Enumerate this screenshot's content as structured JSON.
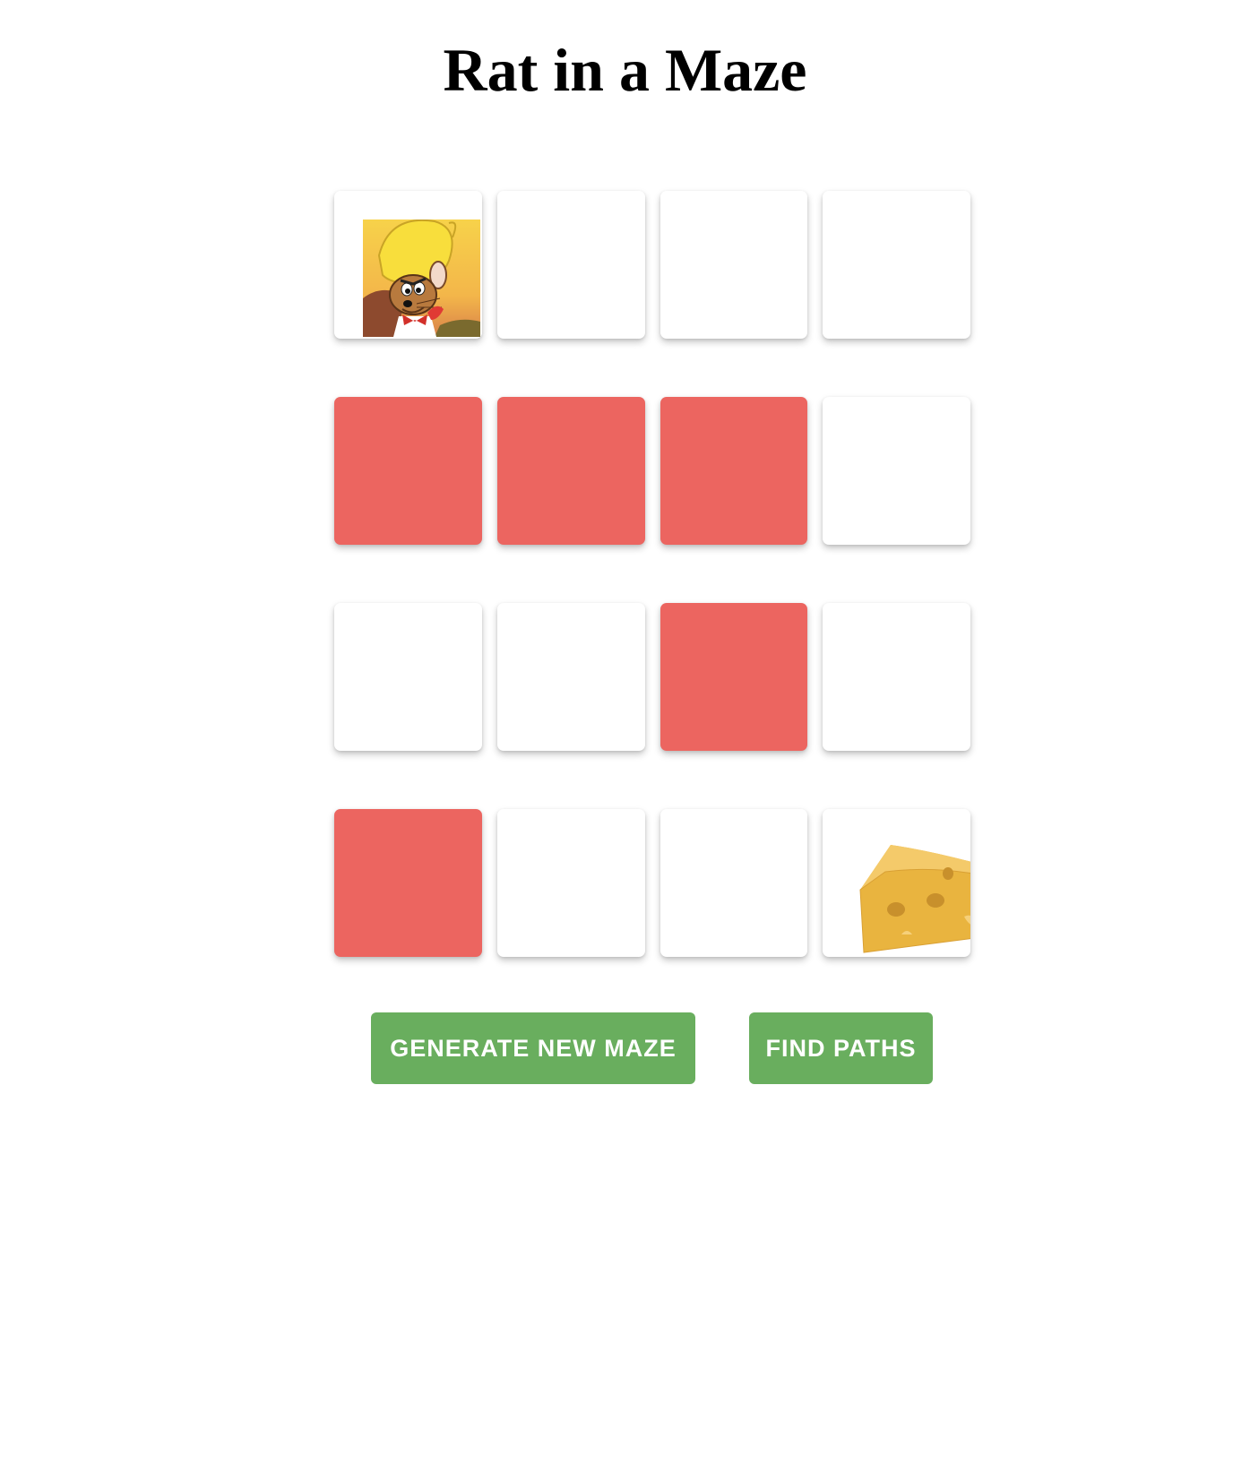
{
  "page": {
    "title": "Rat in a Maze"
  },
  "colors": {
    "open_cell": "#ffffff",
    "blocked_cell": "#ec6560",
    "button": "#69ae5e",
    "button_text": "#ffffff"
  },
  "maze": {
    "rows": 4,
    "cols": 4,
    "cells": [
      [
        "rat",
        "open",
        "open",
        "open"
      ],
      [
        "blocked",
        "blocked",
        "blocked",
        "open"
      ],
      [
        "open",
        "open",
        "blocked",
        "open"
      ],
      [
        "blocked",
        "open",
        "open",
        "cheese"
      ]
    ],
    "rat_icon": "cartoon-mouse-icon",
    "cheese_icon": "cheese-icon"
  },
  "controls": {
    "generate_label": "GENERATE NEW MAZE",
    "find_label": "FIND PATHS"
  }
}
